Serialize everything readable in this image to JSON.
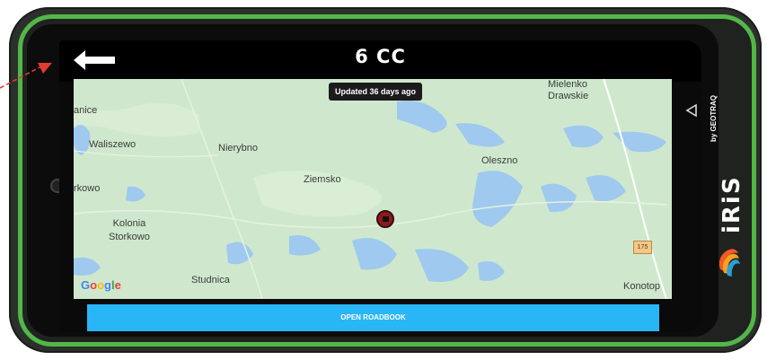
{
  "header": {
    "title": "6 CC"
  },
  "map": {
    "updated_label": "Updated 36 days ago",
    "places": {
      "mielenko": "Mielenko\nDrawskie",
      "anice": "anice",
      "waliszewo": "Waliszewo",
      "nierybno": "Nierybno",
      "ziemsko": "Ziemsko",
      "oleszno": "Oleszno",
      "rkowo": "rkowo",
      "kolonia": "Kolonia\nStorkowo",
      "studnica": "Studnica",
      "konotop": "Konotop"
    },
    "road_number": "175",
    "attribution": "Google"
  },
  "actions": {
    "open_roadbook": "OPEN ROADBOOK"
  },
  "device": {
    "brand": "iRiS",
    "brand_sub": "by GEOTRAQ"
  },
  "colors": {
    "accent_button": "#29b6f6",
    "bumper": "#53b748",
    "marker": "#8b1a1a"
  },
  "icons": {
    "back": "back-arrow-icon",
    "nav_back": "triangle-back-icon",
    "marker": "location-marker-icon"
  }
}
